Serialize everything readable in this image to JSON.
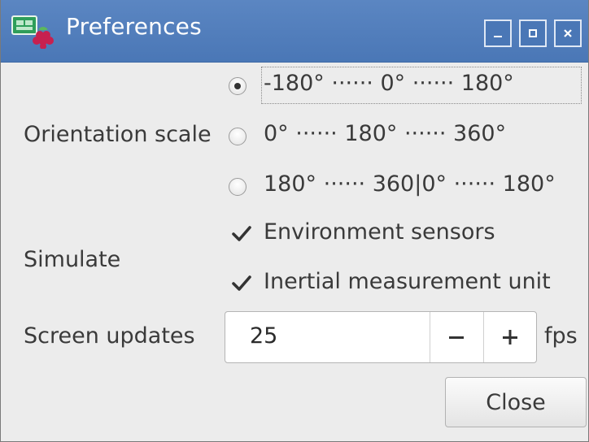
{
  "window": {
    "title": "Preferences",
    "icon": "raspberry-pi-app-icon",
    "controls": {
      "minimize_icon": "minimize-icon",
      "maximize_icon": "maximize-icon",
      "close_icon": "close-icon"
    }
  },
  "orientation": {
    "label": "Orientation scale",
    "options": [
      {
        "label": "-180° ······ 0° ······ 180°",
        "selected": true
      },
      {
        "label": "0° ······ 180° ······ 360°",
        "selected": false
      },
      {
        "label": "180° ······ 360|0° ······ 180°",
        "selected": false
      }
    ]
  },
  "simulate": {
    "label": "Simulate",
    "options": [
      {
        "label": "Environment sensors",
        "checked": true
      },
      {
        "label": "Inertial measurement unit",
        "checked": true
      }
    ]
  },
  "screen_updates": {
    "label": "Screen updates",
    "value": "25",
    "decrement_label": "−",
    "increment_label": "+",
    "unit": "fps"
  },
  "buttons": {
    "close_label": "Close"
  },
  "colors": {
    "titlebar": "#4a77b6",
    "title_text": "#ffffff",
    "background": "#ececec"
  }
}
